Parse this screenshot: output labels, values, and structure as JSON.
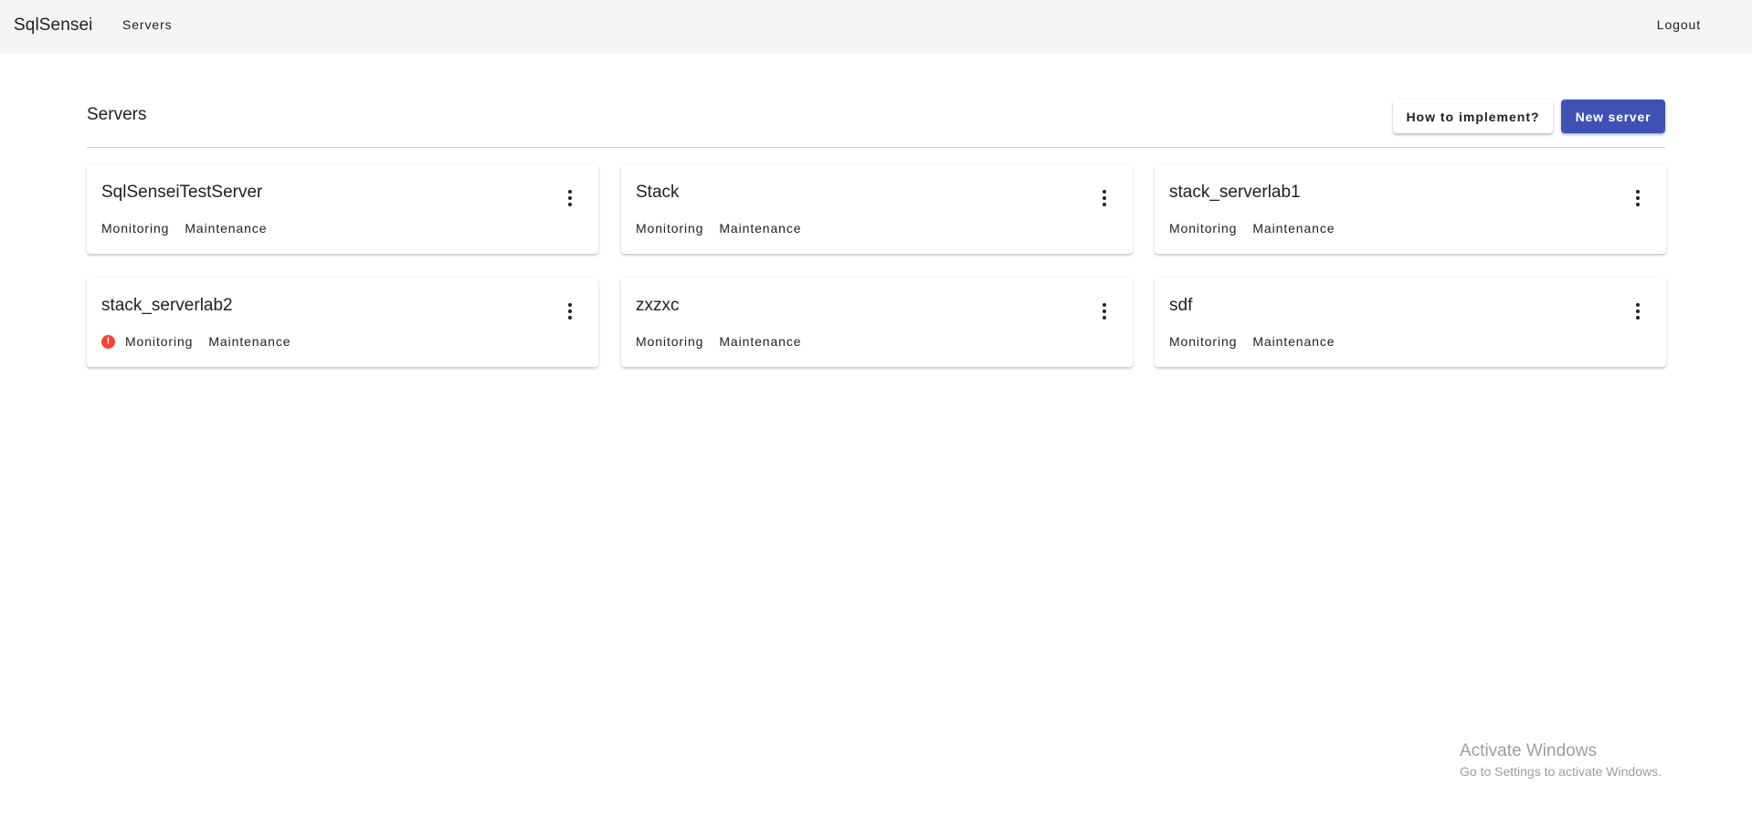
{
  "header": {
    "brand": "SqlSensei",
    "nav_servers": "Servers",
    "logout": "Logout"
  },
  "page": {
    "title": "Servers",
    "how_to_button": "How to implement?",
    "new_server_button": "New server"
  },
  "servers": [
    {
      "name": "SqlSenseiTestServer",
      "monitoring": "Monitoring",
      "maintenance": "Maintenance",
      "alert": false
    },
    {
      "name": "Stack",
      "monitoring": "Monitoring",
      "maintenance": "Maintenance",
      "alert": false
    },
    {
      "name": "stack_serverlab1",
      "monitoring": "Monitoring",
      "maintenance": "Maintenance",
      "alert": false
    },
    {
      "name": "stack_serverlab2",
      "monitoring": "Monitoring",
      "maintenance": "Maintenance",
      "alert": true
    },
    {
      "name": "zxzxc",
      "monitoring": "Monitoring",
      "maintenance": "Maintenance",
      "alert": false
    },
    {
      "name": "sdf",
      "monitoring": "Monitoring",
      "maintenance": "Maintenance",
      "alert": false
    }
  ],
  "icons": {
    "alert": "alert-circle-icon",
    "menu": "more-vert-icon"
  },
  "colors": {
    "primary": "#3f51b5",
    "alert": "#f44336",
    "topbar": "#f5f5f5"
  },
  "watermark": {
    "title": "Activate Windows",
    "subtitle": "Go to Settings to activate Windows."
  }
}
